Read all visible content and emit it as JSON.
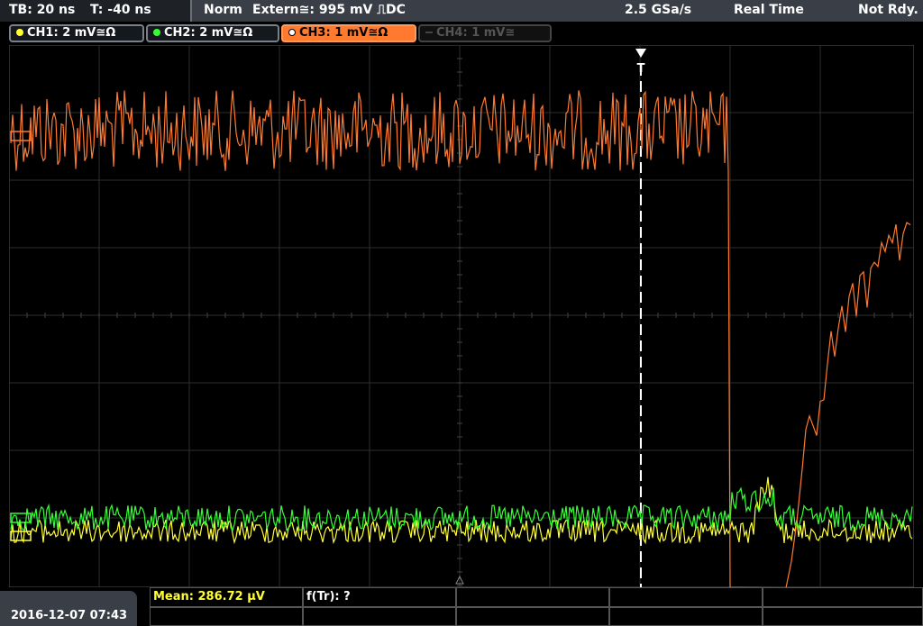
{
  "header": {
    "timebase": "TB: 20 ns",
    "trigger_time": "T: -40 ns",
    "trigger_mode": "Norm",
    "trigger_source": "Extern≅: 995 mV ⎍DC",
    "sample_rate": "2.5 GSa/s",
    "acq_mode": "Real Time",
    "status": "Not Rdy."
  },
  "channels": [
    {
      "label": "CH1: 2 mV≅Ω",
      "color": "#ffff33",
      "state": "on"
    },
    {
      "label": "CH2: 2 mV≅Ω",
      "color": "#33ff33",
      "state": "on"
    },
    {
      "label": "CH3: 1 mV≅Ω",
      "color": "#ff7a2f",
      "state": "active"
    },
    {
      "label": "CH4: 1 mV≅",
      "color": "#555555",
      "state": "off"
    }
  ],
  "screen": {
    "trigger_marker": "T"
  },
  "footer": {
    "datetime": "2016-12-07 07:43",
    "mean": "Mean: 286.72 µV",
    "freq": "f(Tr): ?"
  },
  "colors": {
    "ch1": "#ffff33",
    "ch2": "#33ff33",
    "ch3": "#ff7a2f",
    "grid": "#333333"
  }
}
